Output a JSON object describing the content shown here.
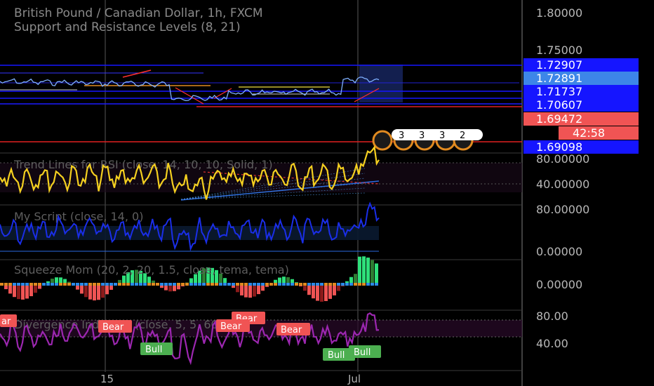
{
  "header": {
    "symbol": "British Pound / Canadian Dollar, 1h, FXCM",
    "indicator": "Support and Resistance Levels (8, 21)"
  },
  "price_axis": {
    "ticks": [
      "1.80000",
      "1.75000"
    ]
  },
  "price_tags": [
    {
      "value": "1.72907",
      "color": "#1515ff"
    },
    {
      "value": "1.72891",
      "color": "#3d86e8"
    },
    {
      "value": "1.71737",
      "color": "#1515ff"
    },
    {
      "value": "1.70607",
      "color": "#1515ff"
    },
    {
      "value": "1.69472",
      "color": "#f05454"
    },
    {
      "value": "42:58",
      "color": "#f05454"
    },
    {
      "value": "1.69098",
      "color": "#1515ff"
    }
  ],
  "event_badges": [
    "3",
    "3",
    "3",
    "2"
  ],
  "panes": {
    "rsi_trend": {
      "title": "Trend Lines for RSI (close, 14, 10, 10, Solid, 1)",
      "ticks": [
        "80.00000",
        "40.00000"
      ]
    },
    "my_script": {
      "title": "My Script (close, 14, 0)",
      "ticks": [
        "80.00000",
        "0.00000"
      ]
    },
    "squeeze": {
      "title": "Squeeze Mom (20, 2, 20, 1.5, close, tema, tema)",
      "ticks": [
        "0.00000"
      ]
    },
    "divergence": {
      "title": "Divergence Indicator (close, 5, 5, 60, 5)",
      "ticks": [
        "80.00",
        "40.00"
      ],
      "signals": [
        {
          "label": "ar",
          "kind": "bear"
        },
        {
          "label": "Bear",
          "kind": "bear"
        },
        {
          "label": "Bear",
          "kind": "bear"
        },
        {
          "label": "Bear",
          "kind": "bear"
        },
        {
          "label": "Bear",
          "kind": "bear"
        },
        {
          "label": "Bull",
          "kind": "bull"
        },
        {
          "label": "Bull",
          "kind": "bull"
        },
        {
          "label": "Bull",
          "kind": "bull"
        }
      ]
    }
  },
  "time_axis": {
    "labels": [
      "15",
      "Jul"
    ]
  },
  "colors": {
    "background": "#000000",
    "bull": "#4caf50",
    "bear": "#f05454",
    "rsi_line": "#f5d020",
    "script_line": "#1a2ee8",
    "divergence_line": "#9c27b0",
    "support_blue": "#1515ff",
    "resistance_red": "#e02020"
  },
  "chart_data": {
    "type": "line",
    "x_labels": [
      "15",
      "Jul"
    ],
    "price_range": [
      1.69,
      1.8
    ],
    "current_price": 1.72891,
    "levels": [
      1.72907,
      1.71737,
      1.70607,
      1.69472,
      1.69098
    ],
    "series": [
      {
        "name": "Trend Lines for RSI",
        "range": [
          20,
          90
        ],
        "ticks": [
          80,
          40
        ]
      },
      {
        "name": "My Script",
        "range": [
          0,
          100
        ],
        "ticks": [
          80,
          0
        ]
      },
      {
        "name": "Squeeze Mom",
        "range": [
          -1,
          1
        ],
        "ticks": [
          0
        ]
      },
      {
        "name": "Divergence Indicator",
        "range": [
          20,
          90
        ],
        "ticks": [
          80,
          40
        ]
      }
    ]
  }
}
